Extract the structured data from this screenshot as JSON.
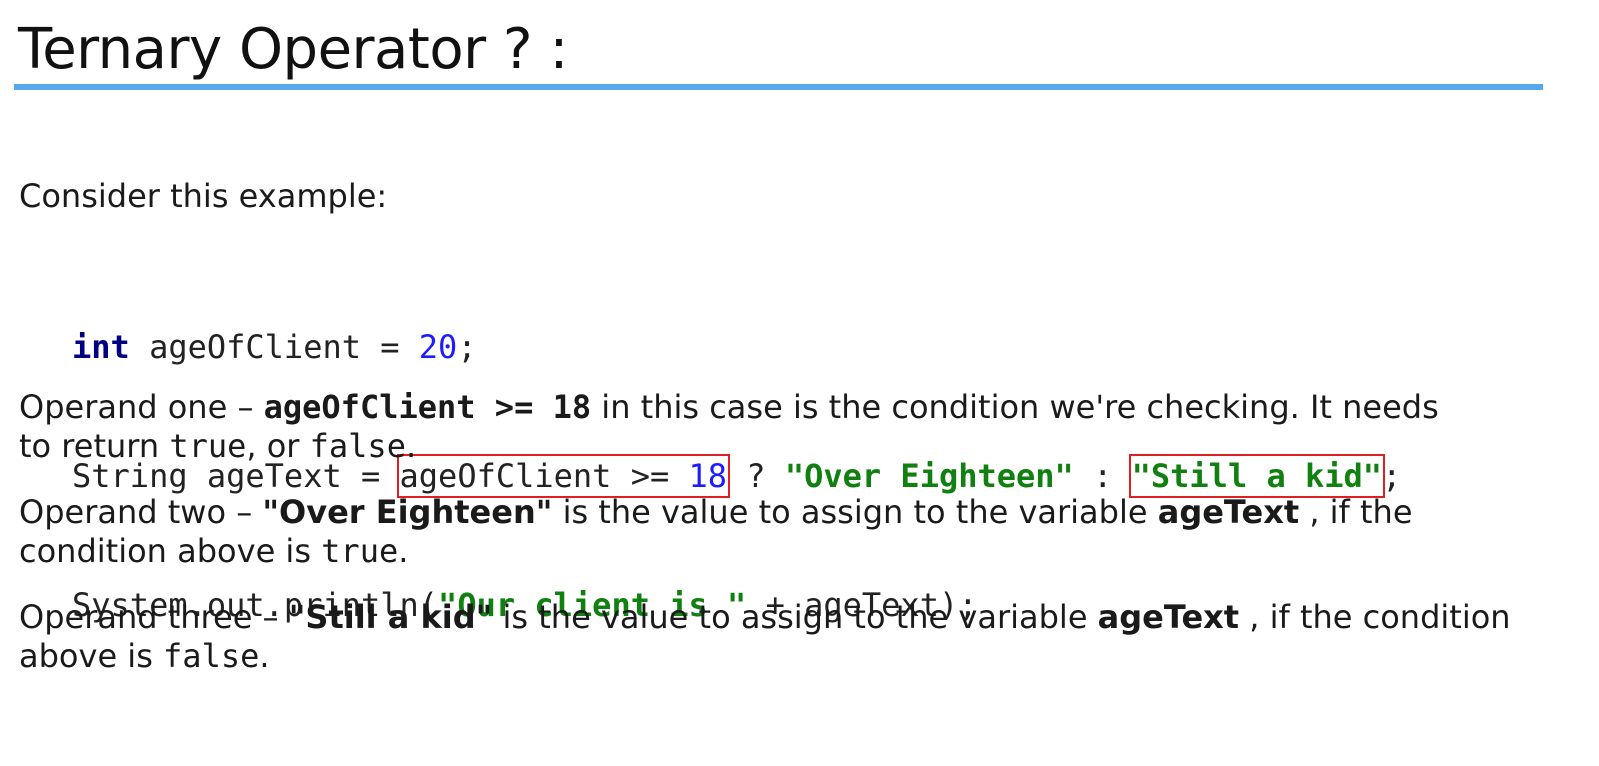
{
  "slide": {
    "title": "Ternary Operator ? :",
    "intro": "Consider this example:"
  },
  "code": {
    "line1": {
      "kw": "int",
      "rest1": " ageOfClient = ",
      "num": "20",
      "rest2": ";"
    },
    "line2": {
      "prefix": "String ageText = ",
      "cond_a": "ageOfClient >= ",
      "cond_num": "18",
      "op1": " ? ",
      "str1": "\"Over Eighteen\"",
      "op2": " : ",
      "str2": "\"Still a kid\"",
      "end": ";"
    },
    "line3": {
      "prefix": "System.out.println(",
      "str": "\"Our client is \"",
      "suffix": " + ageText);"
    }
  },
  "operands": {
    "one": {
      "lead": "Operand one – ",
      "code": "ageOfClient >= 18",
      "text1": " in this case is the condition we're checking.  It needs",
      "text2": "to return ",
      "val1": "true",
      "text3": ", or ",
      "val2": "false",
      "text4": "."
    },
    "two": {
      "lead": "Operand two – ",
      "value": "\"Over Eighteen\"",
      "text1": " is the value to assign to the variable ",
      "var": "ageText",
      "text2": " , if the",
      "text3": "condition above is ",
      "val": "true",
      "text4": "."
    },
    "three": {
      "lead": "Operand three – ",
      "value": "\"Still a kid\"",
      "text1": " is the value to assign to the variable ",
      "var": "ageText",
      "text2": " , if the condition",
      "text3": "above is ",
      "val": "false",
      "text4": "."
    }
  },
  "colors": {
    "accent_rule": "#57a8ec",
    "keyword": "#000080",
    "number": "#1c1cff",
    "string": "#108010",
    "highlight_box": "#e02020"
  }
}
